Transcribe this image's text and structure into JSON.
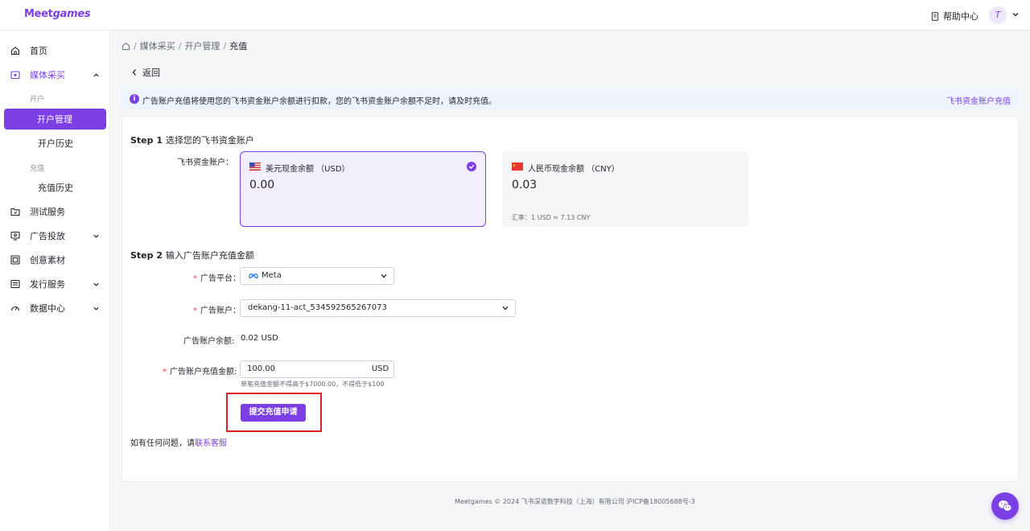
{
  "header": {
    "logo_a": "Meet",
    "logo_b": "games",
    "help_label": "帮助中心",
    "avatar_letter": "T"
  },
  "sidebar": {
    "home": "首页",
    "media_buy": "媒体采买",
    "group_open": "开户",
    "open_manage": "开户管理",
    "open_history": "开户历史",
    "group_recharge": "充值",
    "recharge_history": "充值历史",
    "test_service": "测试服务",
    "ad_delivery": "广告投放",
    "creative": "创意素材",
    "publish": "发行服务",
    "data_center": "数据中心"
  },
  "breadcrumb": {
    "items": [
      "媒体采买",
      "开户管理"
    ],
    "current": "充值"
  },
  "back_label": "返回",
  "info": {
    "text": "广告账户充值将使用您的飞书资金账户余额进行扣款，您的飞书资金账户余额不足时，请及时充值。",
    "link": "飞书资金账户充值"
  },
  "step1": {
    "prefix": "Step 1",
    "title": "选择您的飞书资金账户",
    "field_label": "飞书资金账户：",
    "accounts": [
      {
        "name": "美元现金余额 （USD）",
        "value": "0.00",
        "rate": ""
      },
      {
        "name": "人民币现金余额 （CNY）",
        "value": "0.03",
        "rate": "汇率：1 USD ≈ 7.13 CNY"
      }
    ]
  },
  "step2": {
    "prefix": "Step 2",
    "title": "输入广告账户充值金额",
    "platform_label": "广告平台：",
    "platform_value": "Meta",
    "account_label": "广告账户：",
    "account_value": "dekang-11-act_534592565267073",
    "balance_label": "广告账户余额:",
    "balance_value": "0.02 USD",
    "amount_label": "广告账户充值金额:",
    "amount_value": "100.00",
    "currency": "USD",
    "hint": "单笔充值金额不得高于$7000.00，不得低于$100"
  },
  "submit_label": "提交充值申请",
  "contact": {
    "text": "如有任何问题，请",
    "link": "联系客服"
  },
  "footer": "Meetgames © 2024 飞书深诺数字科技（上海）有限公司 沪ICP备18005688号-3",
  "colors": {
    "accent": "#7b3fe4",
    "highlight_box": "#e02020"
  }
}
